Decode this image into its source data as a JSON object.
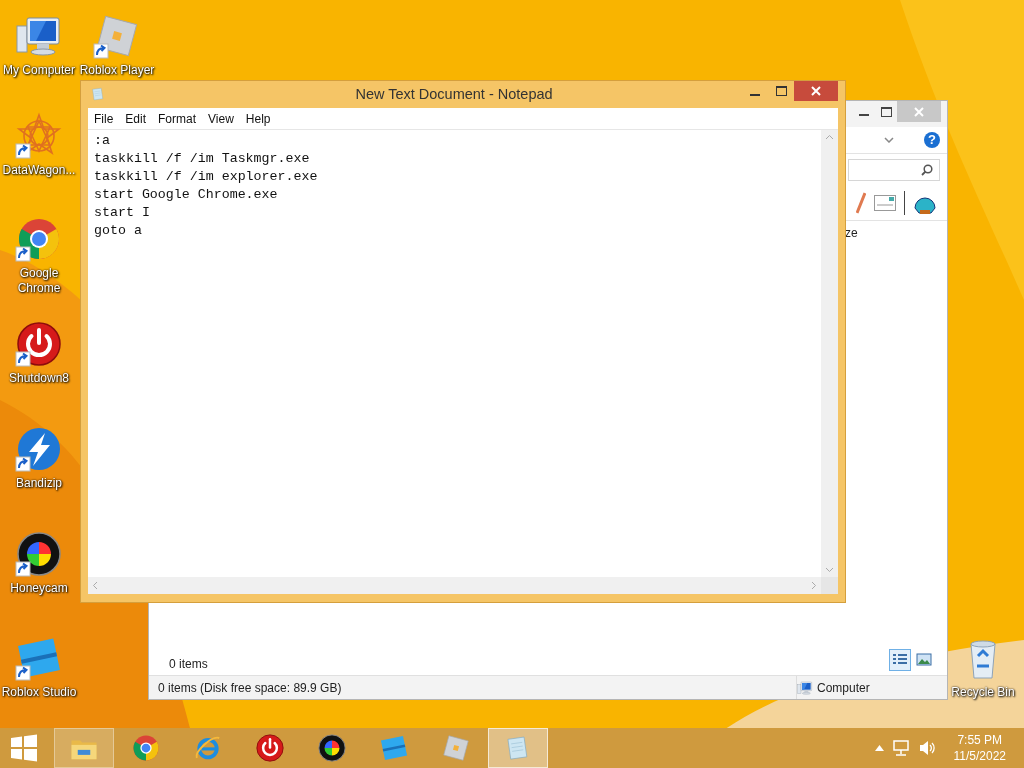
{
  "desktop_icons": [
    {
      "kind": "computer",
      "label": "My Computer",
      "shortcut": false
    },
    {
      "kind": "roblox-player",
      "label": "Roblox Player",
      "shortcut": true
    },
    {
      "kind": "datawagon",
      "label": "DataWagon...",
      "shortcut": true
    },
    {
      "kind": "chrome",
      "label": "Google Chrome",
      "shortcut": true
    },
    {
      "kind": "shutdown",
      "label": "Shutdown8",
      "shortcut": true
    },
    {
      "kind": "bandizip",
      "label": "Bandizip",
      "shortcut": true
    },
    {
      "kind": "honeycam",
      "label": "Honeycam",
      "shortcut": true
    },
    {
      "kind": "roblox-studio",
      "label": "Roblox Studio",
      "shortcut": true
    },
    {
      "kind": "recycle-bin",
      "label": "Recycle Bin",
      "shortcut": false
    }
  ],
  "explorer_window": {
    "help_glyph": "?",
    "column_header": "ze",
    "item_count": "0 items",
    "view_modes": [
      {
        "kind": "details",
        "selected": true
      },
      {
        "kind": "thumbnails",
        "selected": false
      }
    ],
    "status_text": "0 items (Disk free space: 89.9 GB)",
    "location": "Computer"
  },
  "notepad_window": {
    "title": "New Text Document - Notepad",
    "menu": [
      "File",
      "Edit",
      "Format",
      "View",
      "Help"
    ],
    "lines": [
      ":a",
      "taskkill /f /im Taskmgr.exe",
      "taskkill /f /im explorer.exe",
      "start Google Chrome.exe",
      "start I",
      "goto a"
    ]
  },
  "taskbar": {
    "apps": [
      {
        "kind": "explorer",
        "running": true,
        "selected": false
      },
      {
        "kind": "chrome",
        "running": false,
        "selected": false
      },
      {
        "kind": "ie",
        "running": false,
        "selected": false
      },
      {
        "kind": "shutdown",
        "running": false,
        "selected": false
      },
      {
        "kind": "honeycam",
        "running": false,
        "selected": false
      },
      {
        "kind": "roblox-studio",
        "running": false,
        "selected": false
      },
      {
        "kind": "roblox-player",
        "running": false,
        "selected": false
      },
      {
        "kind": "notepad",
        "running": true,
        "selected": true
      }
    ],
    "clock": {
      "time": "7:55 PM",
      "date": "11/5/2022"
    }
  }
}
